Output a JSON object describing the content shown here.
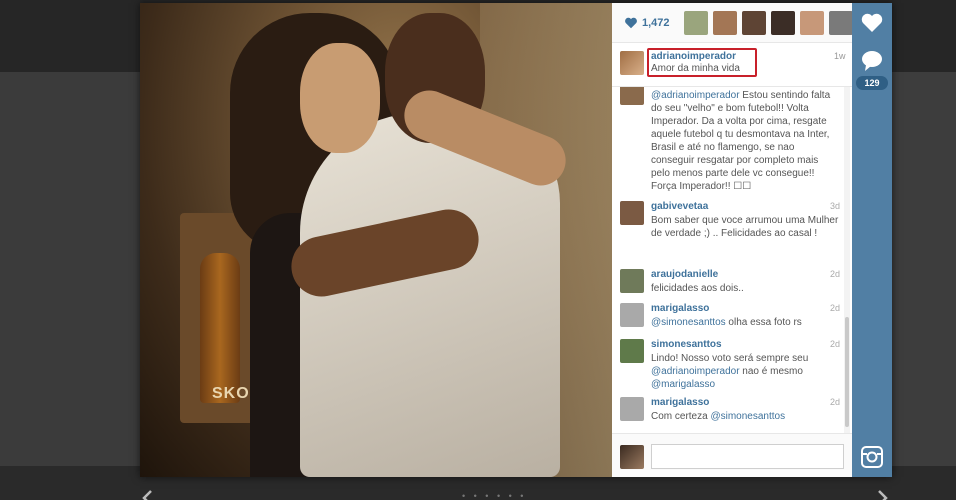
{
  "likes": {
    "count": "1,472"
  },
  "likers": [
    {
      "color": "#9aa57d"
    },
    {
      "color": "#a37655"
    },
    {
      "color": "#5e4434"
    },
    {
      "color": "#3b2d26"
    },
    {
      "color": "#c79879"
    },
    {
      "color": "#7a7a7a"
    }
  ],
  "caption": {
    "username": "adrianoimperador",
    "text": "Amor da minha vida",
    "time": "1w",
    "highlight_color": "#c8202a"
  },
  "comments": [
    {
      "username": "",
      "time": "",
      "segments": [
        {
          "text": "@adrianoimperador",
          "mention": true
        },
        {
          "text": " Estou sentindo falta do seu \"velho\" e bom futebol!! Volta Imperador. Da a volta por cima, resgate aquele futebol q tu desmontava na Inter, Brasil e até no flamengo, se nao conseguir resgatar por completo mais pelo menos parte dele vc consegue!! Força Imperador!! ☐☐",
          "mention": false
        }
      ],
      "avatar_color": "#8a6a4c"
    },
    {
      "username": "gabivevetaa",
      "time": "3d",
      "segments": [
        {
          "text": "Bom saber que voce arrumou uma Mulher de verdade ;) .. Felicidades ao casal !",
          "mention": false
        }
      ],
      "avatar_color": "#7b5a43"
    },
    {
      "username": "araujodanielle",
      "time": "2d",
      "segments": [
        {
          "text": "felicidades aos dois..",
          "mention": false
        }
      ],
      "avatar_color": "#6f7a5a"
    },
    {
      "username": "marigalasso",
      "time": "2d",
      "segments": [
        {
          "text": "@simonesanttos",
          "mention": true
        },
        {
          "text": " olha essa foto rs",
          "mention": false
        }
      ],
      "avatar_color": "#a9a9a9"
    },
    {
      "username": "simonesanttos",
      "time": "2d",
      "segments": [
        {
          "text": "Lindo! Nosso voto será sempre seu ",
          "mention": false
        },
        {
          "text": "@adrianoimperador",
          "mention": true
        },
        {
          "text": " nao é mesmo ",
          "mention": false
        },
        {
          "text": "@marigalasso",
          "mention": true
        }
      ],
      "avatar_color": "#5f7a4a"
    },
    {
      "username": "marigalasso",
      "time": "2d",
      "segments": [
        {
          "text": "Com certeza ",
          "mention": false
        },
        {
          "text": "@simonesanttos",
          "mention": true
        }
      ],
      "avatar_color": "#a9a9a9"
    }
  ],
  "comment_input": {
    "placeholder": ""
  },
  "rail": {
    "comment_count": "129"
  },
  "photo": {
    "label": "SKOL"
  },
  "colors": {
    "link": "#3f729b",
    "rail": "#517fa4"
  },
  "icons": [
    "heart-icon",
    "comment-icon",
    "instagram-icon",
    "left-arrow-icon",
    "right-arrow-icon"
  ]
}
